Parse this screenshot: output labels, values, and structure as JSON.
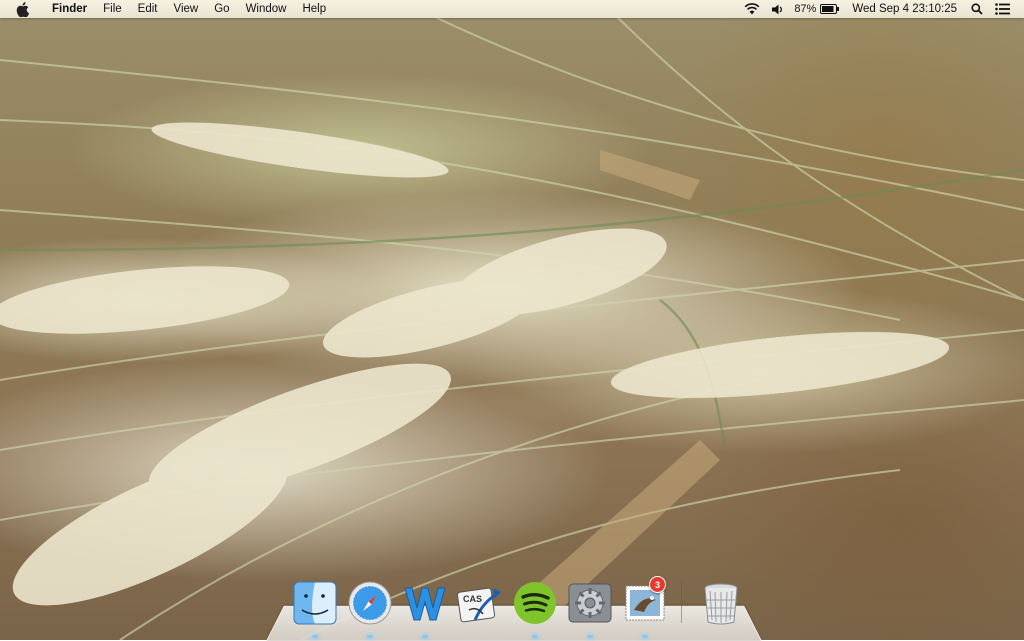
{
  "menubar": {
    "apple_icon": "apple-logo-icon",
    "app_name": "Finder",
    "menus": [
      "File",
      "Edit",
      "View",
      "Go",
      "Window",
      "Help"
    ],
    "status": {
      "wifi_icon": "wifi-icon",
      "volume_icon": "speaker-icon",
      "battery_percent": "87%",
      "battery_icon": "battery-icon",
      "clock": "Wed Sep 4  23:10:25",
      "spotlight_icon": "search-icon",
      "notification_icon": "list-icon"
    }
  },
  "dock": {
    "items": [
      {
        "name": "Finder",
        "icon": "finder-icon",
        "running": true
      },
      {
        "name": "Safari",
        "icon": "safari-compass-icon",
        "running": true
      },
      {
        "name": "Word",
        "icon": "w-letter-icon",
        "running": true
      },
      {
        "name": "CAS",
        "icon": "cas-icon",
        "running": false
      },
      {
        "name": "Spotify",
        "icon": "spotify-icon",
        "running": true
      },
      {
        "name": "System Preferences",
        "icon": "gear-icon",
        "running": true
      },
      {
        "name": "Mail",
        "icon": "mail-stamp-icon",
        "running": true,
        "badge": "3"
      },
      {
        "name": "Trash",
        "icon": "trash-icon",
        "running": false
      }
    ]
  }
}
